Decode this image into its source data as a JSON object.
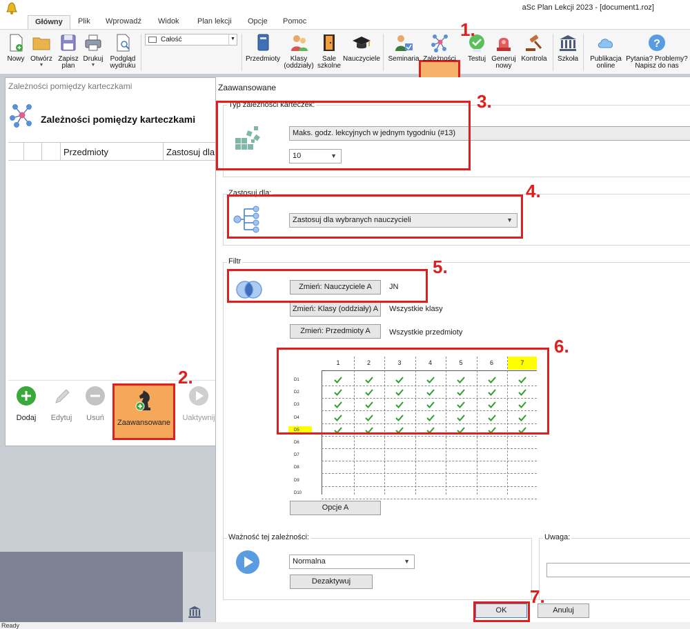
{
  "app": {
    "title": "aSc Plan Lekcji 2023  - [document1.roz]"
  },
  "ribbon_tabs": [
    "Główny",
    "Plik",
    "Wprowadź",
    "Widok",
    "Plan lekcji",
    "Opcje",
    "Pomoc"
  ],
  "ribbon": {
    "file_buttons": [
      {
        "label": "Nowy",
        "label2": ""
      },
      {
        "label": "Otwórz",
        "label2": ""
      },
      {
        "label": "Zapisz",
        "label2": "plan"
      },
      {
        "label": "Drukuj",
        "label2": ""
      },
      {
        "label": "Podgląd",
        "label2": "wydruku"
      }
    ],
    "view_select": "Całość",
    "data_buttons": [
      {
        "label": "Przedmioty",
        "label2": ""
      },
      {
        "label": "Klasy",
        "label2": "(oddziały)"
      },
      {
        "label": "Sale",
        "label2": "szkolne"
      },
      {
        "label": "Nauczyciele",
        "label2": ""
      },
      {
        "label": "Seminaria",
        "label2": ""
      },
      {
        "label": "Zależności",
        "label2": ""
      },
      {
        "label": "Testuj",
        "label2": ""
      },
      {
        "label": "Generuj",
        "label2": "nowy"
      },
      {
        "label": "Kontrola",
        "label2": ""
      },
      {
        "label": "Szkoła",
        "label2": ""
      },
      {
        "label": "Publikacja",
        "label2": "online"
      },
      {
        "label": "Pytania? Problemy?",
        "label2": "Napisz do nas"
      }
    ]
  },
  "left_dialog": {
    "title": "Zależności pomiędzy karteczkami",
    "heading": "Zależności pomiędzy karteczkami",
    "columns": [
      "Przedmioty",
      "Zastosuj dla"
    ],
    "footer_buttons": [
      "Dodaj",
      "Edytuj",
      "Usuń",
      "Zaawansowane",
      "Uaktywnij"
    ]
  },
  "advanced": {
    "title": "Zaawansowane",
    "type_group": "Typ zależności karteczek:",
    "type_value": "Maks. godz. lekcyjnych w jednym tygodniu (#13)",
    "type_number": "10",
    "apply_group": "Zastosuj dla:",
    "apply_value": "Zastosuj dla wybranych nauczycieli",
    "filter_group": "Filtr",
    "filter_rows": [
      {
        "button": "Zmień: Nauczyciele A",
        "value": "JN"
      },
      {
        "button": "Zmień: Klasy (oddziały) A",
        "value": "Wszystkie klasy"
      },
      {
        "button": "Zmień: Przedmioty A",
        "value": "Wszystkie przedmioty"
      }
    ],
    "grid_columns": [
      "1",
      "2",
      "3",
      "4",
      "5",
      "6",
      "7"
    ],
    "grid_rows": [
      "D1",
      "D2",
      "D3",
      "D4",
      "D5",
      "D6",
      "D7",
      "D8",
      "D9",
      "D10"
    ],
    "grid_checked_rows": 5,
    "options_button": "Opcje A",
    "importance_group": "Ważność tej zależności:",
    "importance_value": "Normalna",
    "deactivate_button": "Dezaktywuj",
    "note_group": "Uwaga:",
    "ok": "OK",
    "cancel": "Anuluj"
  },
  "status": "Ready",
  "steps": [
    "1.",
    "2.",
    "3.",
    "4.",
    "5.",
    "6.",
    "7."
  ],
  "colors": {
    "highlight_red": "#e01e1e",
    "accent_orange": "#f5a85a",
    "check_green": "#2e9e2e",
    "grid_yellow": "#ffff00"
  }
}
